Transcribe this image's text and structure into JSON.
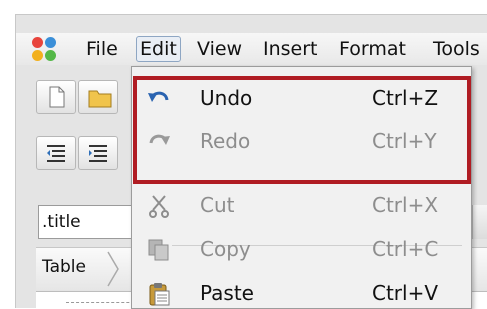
{
  "menubar": {
    "items": [
      {
        "label": "File"
      },
      {
        "label": "Edit"
      },
      {
        "label": "View"
      },
      {
        "label": "Insert"
      },
      {
        "label": "Format"
      },
      {
        "label": "Tools"
      }
    ]
  },
  "style_box": {
    "value": ".title"
  },
  "breadcrumb": {
    "first": "Table"
  },
  "edit_menu": {
    "items": [
      {
        "label": "Undo",
        "shortcut": "Ctrl+Z",
        "icon": "undo-icon",
        "enabled": true
      },
      {
        "label": "Redo",
        "shortcut": "Ctrl+Y",
        "icon": "redo-icon",
        "enabled": false
      },
      {
        "label": "Cut",
        "shortcut": "Ctrl+X",
        "icon": "scissors-icon",
        "enabled": false
      },
      {
        "label": "Copy",
        "shortcut": "Ctrl+C",
        "icon": "copy-icon",
        "enabled": false
      },
      {
        "label": "Paste",
        "shortcut": "Ctrl+V",
        "icon": "paste-icon",
        "enabled": true
      }
    ]
  },
  "colors": {
    "highlight_border": "#b01c23",
    "active_menu_border": "#8ea6c3"
  }
}
